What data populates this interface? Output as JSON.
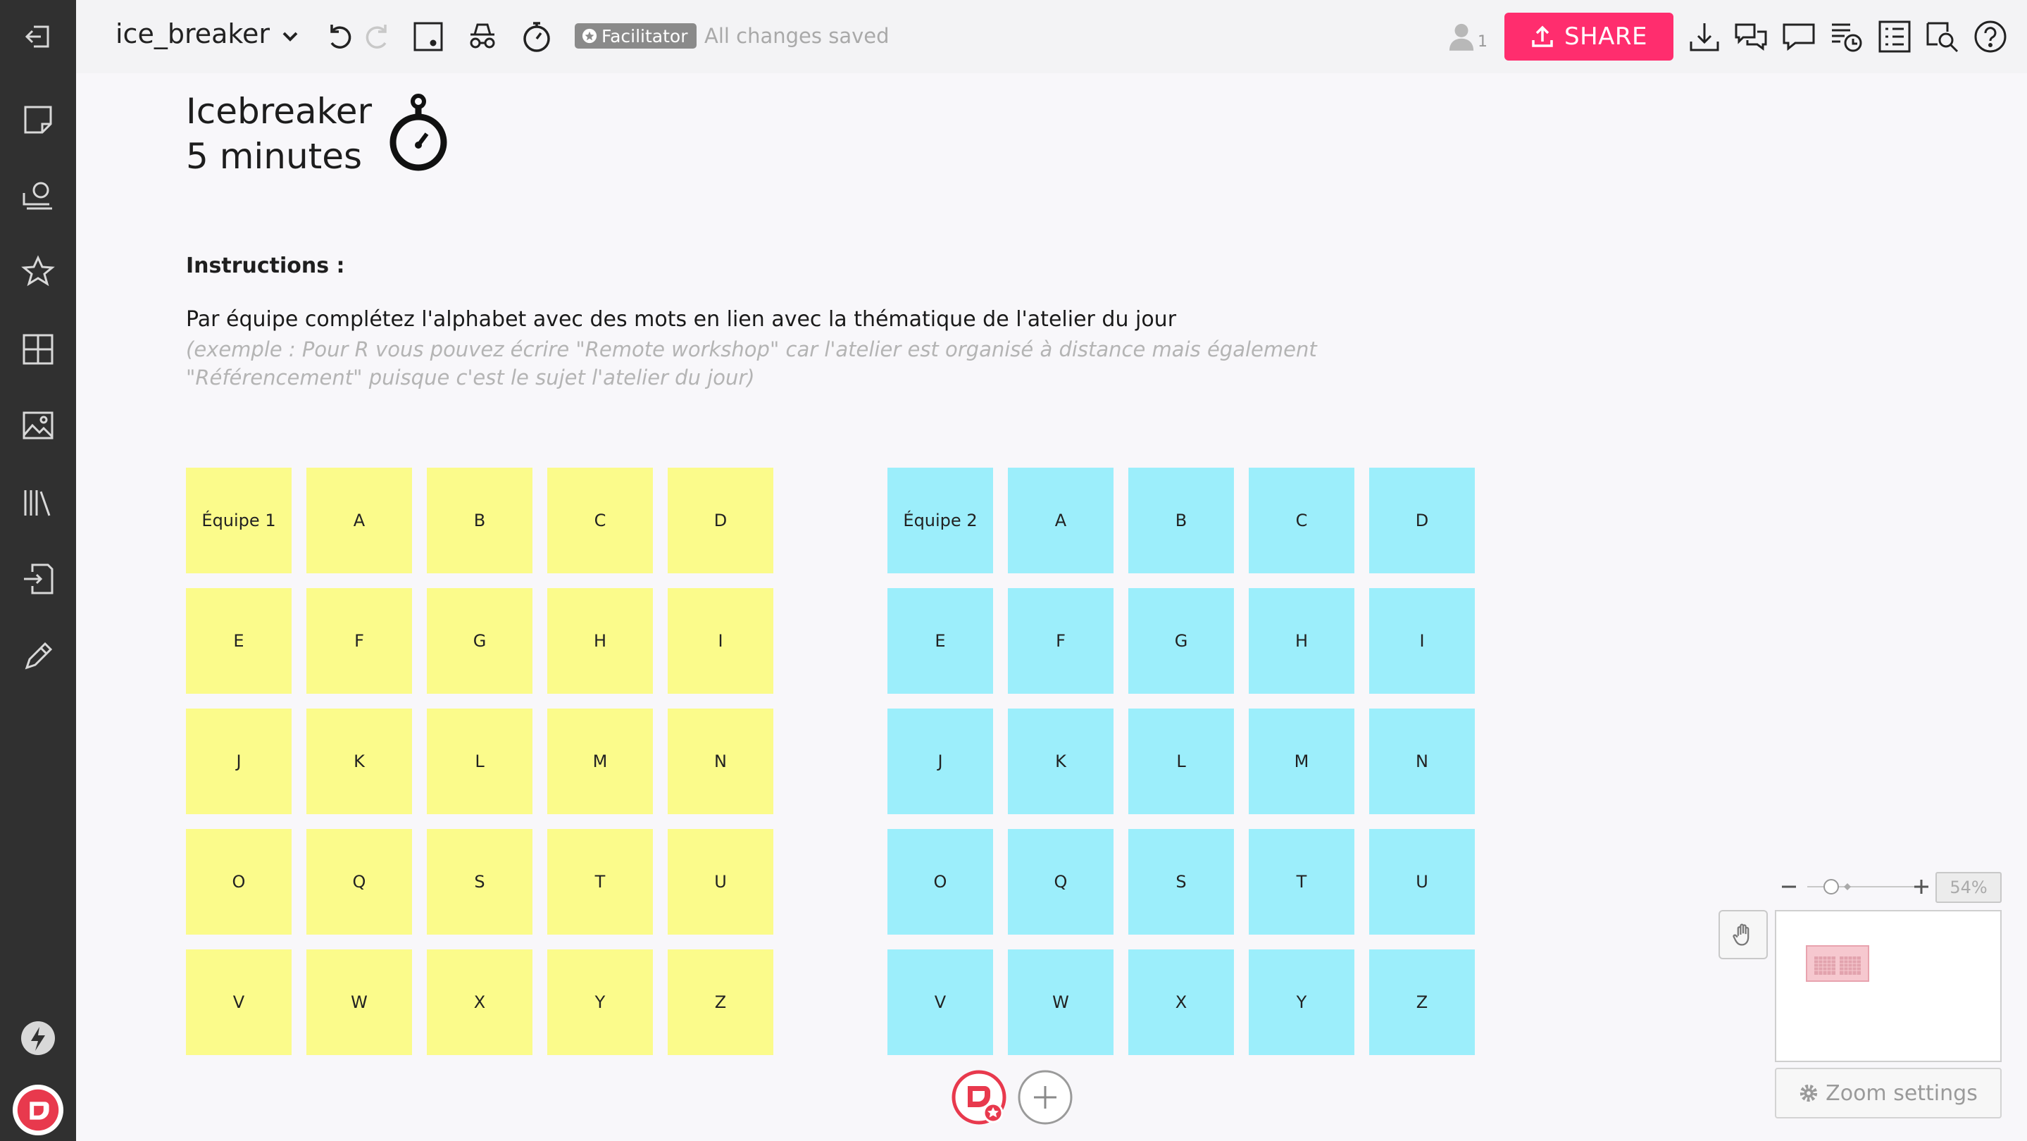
{
  "topbar": {
    "board_name": "ice_breaker",
    "facilitator_label": "Facilitator",
    "saved_status": "All changes saved",
    "user_count": "1",
    "share_label": "SHARE"
  },
  "canvas": {
    "title_line1": "Icebreaker",
    "title_line2": "5 minutes",
    "instructions_title": "Instructions :",
    "instructions_text": "Par équipe complétez l'alphabet avec des mots en lien avec la thématique de l'atelier du jour",
    "example_line1": "(exemple : Pour R vous pouvez écrire \"Remote workshop\" car l'atelier est organisé à distance mais également",
    "example_line2": "\"Référencement\" puisque c'est le sujet l'atelier du jour)"
  },
  "team1": {
    "color": "#fbfb8b",
    "notes": [
      "Équipe 1",
      "A",
      "B",
      "C",
      "D",
      "E",
      "F",
      "G",
      "H",
      "I",
      "J",
      "K",
      "L",
      "M",
      "N",
      "O",
      "Q",
      "S",
      "T",
      "U",
      "V",
      "W",
      "X",
      "Y",
      "Z"
    ]
  },
  "team2": {
    "color": "#9ceefb",
    "notes": [
      "Équipe 2",
      "A",
      "B",
      "C",
      "D",
      "E",
      "F",
      "G",
      "H",
      "I",
      "J",
      "K",
      "L",
      "M",
      "N",
      "O",
      "Q",
      "S",
      "T",
      "U",
      "V",
      "W",
      "X",
      "Y",
      "Z"
    ]
  },
  "zoom": {
    "percent": "54%",
    "settings_label": "Zoom settings"
  },
  "colors": {
    "accent": "#ff2d6e",
    "sidebar": "#303030"
  }
}
